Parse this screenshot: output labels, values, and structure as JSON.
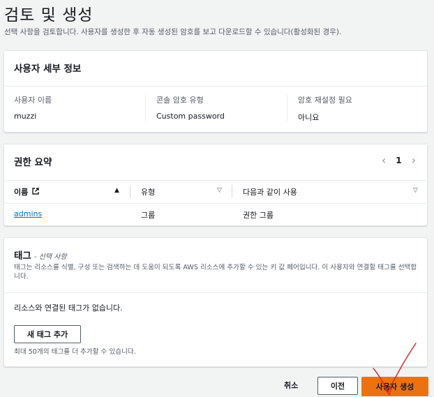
{
  "page": {
    "title": "검토 및 생성",
    "subtitle": "선택 사항을 검토합니다. 사용자를 생성한 후 자동 생성된 암호를 보고 다운로드할 수 있습니다(활성화된 경우)."
  },
  "user_details": {
    "heading": "사용자 세부 정보",
    "fields": [
      {
        "label": "사용자 이름",
        "value": "muzzi"
      },
      {
        "label": "콘솔 암호 유형",
        "value": "Custom password"
      },
      {
        "label": "암호 재설정 필요",
        "value": "아니요"
      }
    ]
  },
  "permissions": {
    "heading": "권한 요약",
    "page_number": "1",
    "columns": [
      "이름",
      "유형",
      "다음과 같이 사용"
    ],
    "rows": [
      {
        "name": "admins",
        "type": "그룹",
        "used_as": "권한 그룹"
      }
    ]
  },
  "tags": {
    "heading": "태그",
    "optional": "- 선택 사항",
    "description": "태그는 리소스를 식별, 구성 또는 검색하는 데 도움이 되도록 AWS 리소스에 추가할 수 있는 키 값 페어입니다. 이 사용자와 연결할 태그를 선택합니다.",
    "empty_message": "리소스와 연결된 태그가 없습니다.",
    "add_button": "새 태그 추가",
    "limit_note": "최대 50개의 태그를 더 추가할 수 있습니다."
  },
  "footer": {
    "cancel": "취소",
    "previous": "이전",
    "create": "사용자 생성"
  },
  "colors": {
    "primary_button": "#ec7211",
    "link": "#0073bb",
    "annotation": "#e02020"
  }
}
